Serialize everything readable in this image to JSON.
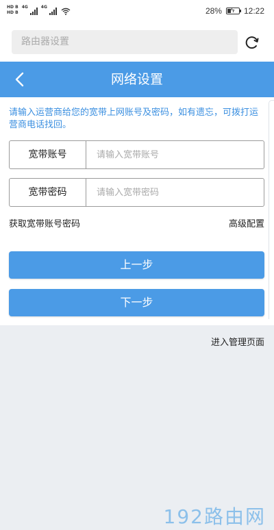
{
  "status_bar": {
    "sim1": "HD",
    "sim1_sub": "B",
    "sim2": "HD",
    "sim2_sub": "B",
    "net1": "4G",
    "net2": "4G",
    "battery_percent": "28%",
    "time": "12:22"
  },
  "search": {
    "placeholder": "路由器设置"
  },
  "header": {
    "title": "网络设置"
  },
  "notice": "请输入运营商给您的宽带上网账号及密码，如有遗忘，可拨打运营商电话找回。",
  "form": {
    "account_label": "宽带账号",
    "account_placeholder": "请输入宽带账号",
    "account_value": "",
    "password_label": "宽带密码",
    "password_placeholder": "请输入宽带密码",
    "password_value": ""
  },
  "links": {
    "get_credentials": "获取宽带账号密码",
    "advanced": "高级配置",
    "manage_page": "进入管理页面"
  },
  "buttons": {
    "prev": "上一步",
    "next": "下一步"
  },
  "watermark": "192路由网",
  "colors": {
    "accent": "#4b9be6",
    "notice_text": "#3b8fe0"
  },
  "icons": [
    "back-arrow-icon",
    "refresh-icon",
    "wifi-icon",
    "signal-icon",
    "battery-icon"
  ]
}
